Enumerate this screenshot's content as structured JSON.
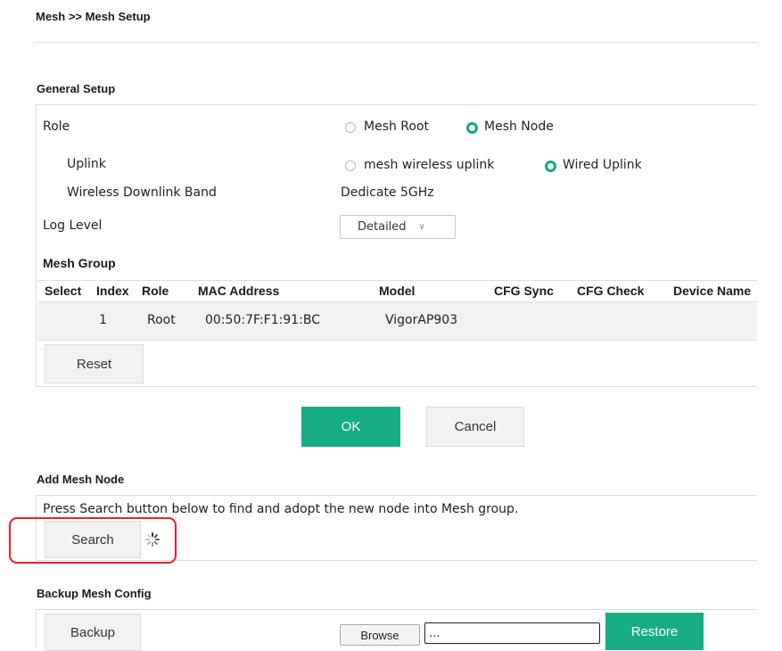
{
  "breadcrumb": "Mesh >> Mesh Setup",
  "general": {
    "title": "General Setup",
    "role_label": "Role",
    "role_options": [
      "Mesh Root",
      "Mesh Node"
    ],
    "uplink_label": "Uplink",
    "uplink_options": [
      "mesh wireless uplink",
      "Wired Uplink"
    ],
    "downlink_label": "Wireless Downlink Band",
    "downlink_value": "Dedicate 5GHz",
    "log_label": "Log Level",
    "log_value": "Detailed"
  },
  "mesh_group": {
    "title": "Mesh Group",
    "columns": [
      "Select",
      "Index",
      "Role",
      "MAC Address",
      "Model",
      "CFG Sync",
      "CFG Check",
      "Device Name"
    ],
    "rows": [
      {
        "index": "1",
        "role": "Root",
        "mac": "00:50:7F:F1:91:BC",
        "model": "VigorAP903"
      }
    ],
    "reset_label": "Reset"
  },
  "actions": {
    "ok_label": "OK",
    "cancel_label": "Cancel"
  },
  "add_node": {
    "title": "Add Mesh Node",
    "description": "Press Search button below to find and adopt the new node into Mesh group.",
    "search_label": "Search"
  },
  "backup": {
    "title": "Backup Mesh Config",
    "backup_label": "Backup",
    "browse_label": "Browse",
    "file_value": "...",
    "restore_label": "Restore"
  },
  "colors": {
    "accent": "#17ae86",
    "highlight": "#e8202a"
  }
}
